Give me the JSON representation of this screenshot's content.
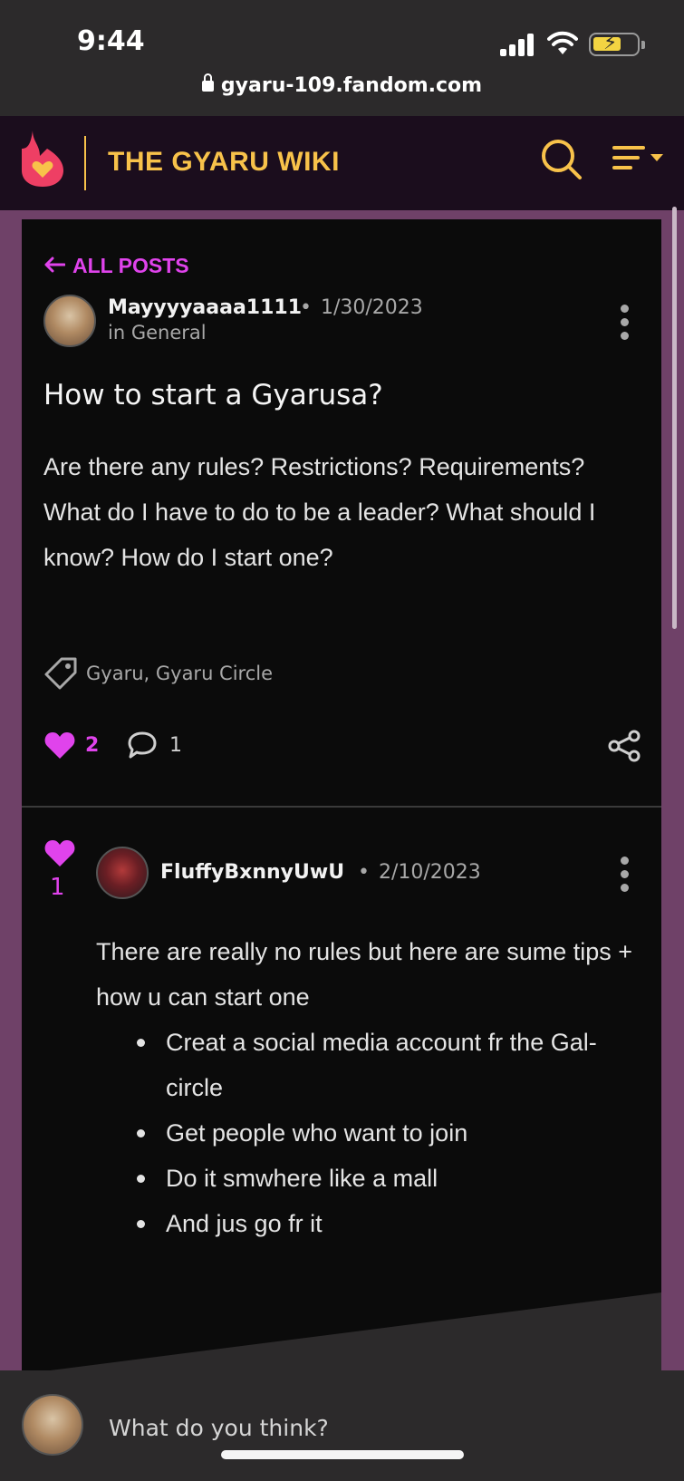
{
  "status_bar": {
    "time": "9:44",
    "url": "gyaru-109.fandom.com"
  },
  "header": {
    "wiki_title": "THE GYARU WIKI"
  },
  "post": {
    "back_label": "ALL POSTS",
    "author": "Mayyyyaaaa1111",
    "date": "1/30/2023",
    "category": "in General",
    "title": "How to start a Gyarusa?",
    "body": "Are there any rules? Restrictions? Requirements? What do I have to do to be a leader? What should I know? How do I start one?",
    "tags": "Gyaru, Gyaru Circle",
    "likes": "2",
    "comments": "1"
  },
  "reply": {
    "likes": "1",
    "author": "FluffyBxnnyUwU",
    "date": "2/10/2023",
    "intro": "There are really no rules but here are sume tips + how u can start one",
    "items": [
      "Creat a social media account fr the Gal-circle",
      "Get people who want to join",
      "Do it smwhere like a mall",
      "And jus go fr it"
    ]
  },
  "composer": {
    "placeholder": "What do you think?"
  },
  "colors": {
    "accent": "#e043ec",
    "brand": "#f8c24a",
    "header_bg": "#1b0d1d",
    "page_bg": "#6f4168",
    "card_bg": "#0b0b0b"
  },
  "icons": [
    "lock-icon",
    "fandom-logo",
    "search-icon",
    "menu-icon",
    "back-arrow-icon",
    "more-icon",
    "tag-icon",
    "heart-icon",
    "comment-icon",
    "share-icon"
  ]
}
